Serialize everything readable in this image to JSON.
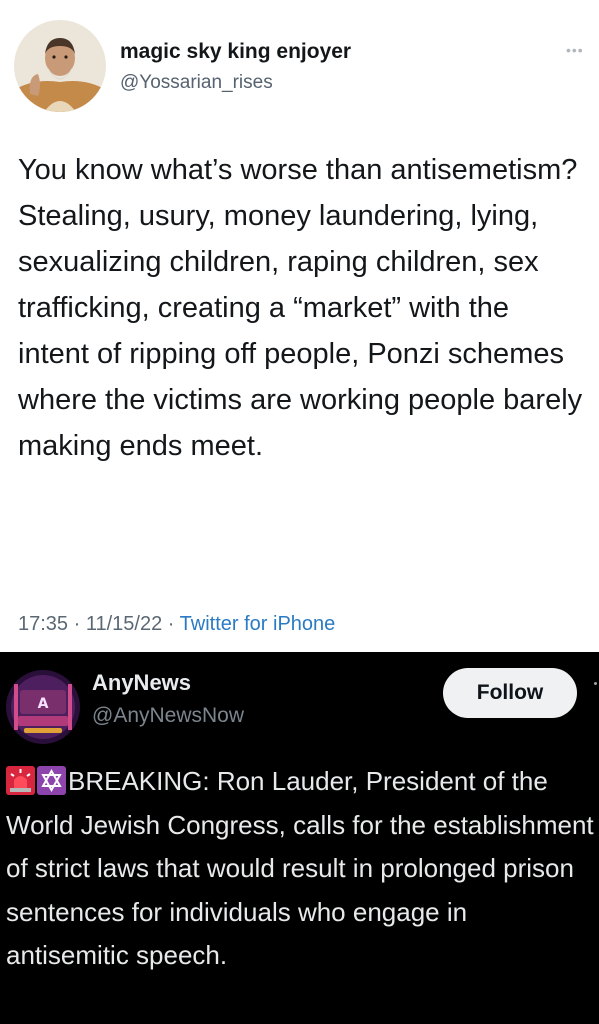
{
  "tweet1": {
    "display_name": "magic sky king enjoyer",
    "handle": "@Yossarian_rises",
    "more_icon": "more-dots-icon",
    "text": "You know what’s worse than antisemetism? Stealing, usury, money laundering, lying, sexualizing children, raping children, sex trafficking, creating a “market” with the intent of ripping off people, Ponzi schemes where the victims are working people barely making ends meet.",
    "time": "17:35",
    "date": "11/15/22",
    "separator": "·",
    "client": "Twitter for iPhone"
  },
  "tweet2": {
    "display_name": "AnyNews",
    "handle": "@AnyNewsNow",
    "follow_label": "Follow",
    "emoji_1": "rotating-light-icon",
    "emoji_2": "star-of-david-icon",
    "text": "BREAKING: Ron Lauder, President of the World Jewish Congress, calls for the establishment of strict laws that would result in prolonged prison sentences for individuals who engage in antisemitic speech."
  },
  "colors": {
    "light_bg": "#ffffff",
    "dark_bg": "#000000",
    "link_blue": "#2b7ac4",
    "follow_button_bg": "#eff1f3"
  }
}
